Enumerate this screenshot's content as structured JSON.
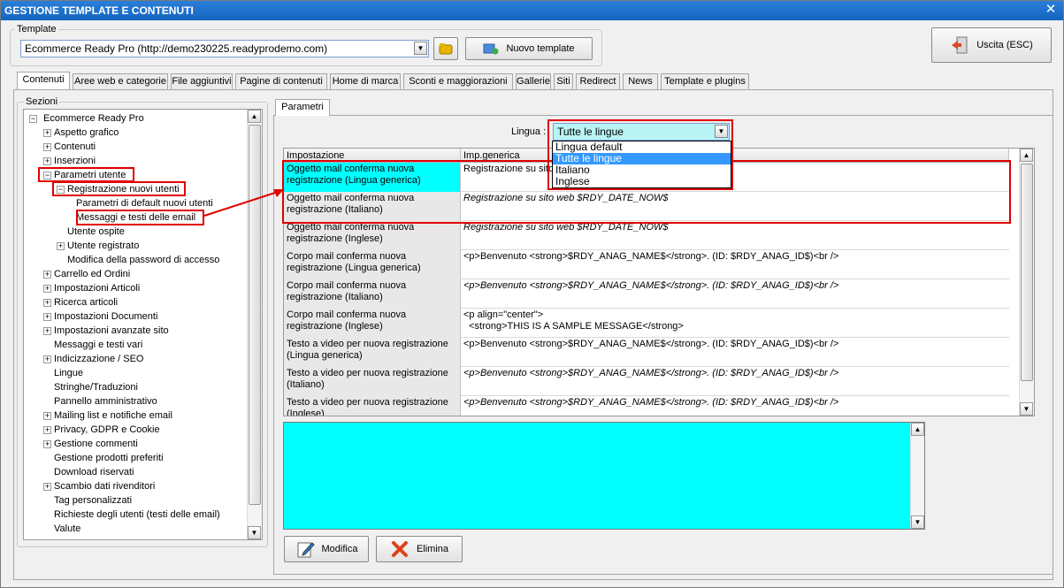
{
  "window": {
    "title": "GESTIONE TEMPLATE E CONTENUTI",
    "close_glyph": "✕"
  },
  "template_group": {
    "label": "Template",
    "selected": "Ecommerce Ready Pro (http://demo230225.readyprodemo.com)",
    "new_template_label": "Nuovo template"
  },
  "exit_button": {
    "label": "Uscita (ESC)"
  },
  "tabs": [
    {
      "label": "Contenuti",
      "active": true
    },
    {
      "label": "Aree web e categorie"
    },
    {
      "label": "File aggiuntivi"
    },
    {
      "label": "Pagine di contenuti"
    },
    {
      "label": "Home di marca"
    },
    {
      "label": "Sconti e maggiorazioni"
    },
    {
      "label": "Gallerie"
    },
    {
      "label": "Siti"
    },
    {
      "label": "Redirect"
    },
    {
      "label": "News"
    },
    {
      "label": "Template e plugins"
    }
  ],
  "sections": {
    "label": "Sezioni",
    "tree": [
      {
        "label": "Ecommerce Ready Pro",
        "level": 0,
        "exp": "−"
      },
      {
        "label": "Aspetto grafico",
        "level": 1,
        "exp": "+"
      },
      {
        "label": "Contenuti",
        "level": 1,
        "exp": "+"
      },
      {
        "label": "Inserzioni",
        "level": 1,
        "exp": "+"
      },
      {
        "label": "Parametri utente",
        "level": 1,
        "exp": "−"
      },
      {
        "label": "Registrazione nuovi utenti",
        "level": 2,
        "exp": "−"
      },
      {
        "label": "Parametri di default nuovi utenti",
        "level": 3
      },
      {
        "label": "Messaggi e testi delle email",
        "level": 3,
        "selected": true
      },
      {
        "label": "Utente ospite",
        "level": 2
      },
      {
        "label": "Utente registrato",
        "level": 2,
        "exp": "+"
      },
      {
        "label": "Modifica della password di accesso",
        "level": 2
      },
      {
        "label": "Carrello ed Ordini",
        "level": 1,
        "exp": "+"
      },
      {
        "label": "Impostazioni Articoli",
        "level": 1,
        "exp": "+"
      },
      {
        "label": "Ricerca articoli",
        "level": 1,
        "exp": "+"
      },
      {
        "label": "Impostazioni Documenti",
        "level": 1,
        "exp": "+"
      },
      {
        "label": "Impostazioni avanzate sito",
        "level": 1,
        "exp": "+"
      },
      {
        "label": "Messaggi e testi vari",
        "level": 1
      },
      {
        "label": "Indicizzazione / SEO",
        "level": 1,
        "exp": "+"
      },
      {
        "label": "Lingue",
        "level": 1
      },
      {
        "label": "Stringhe/Traduzioni",
        "level": 1
      },
      {
        "label": "Pannello amministrativo",
        "level": 1
      },
      {
        "label": "Mailing list e notifiche email",
        "level": 1,
        "exp": "+"
      },
      {
        "label": "Privacy, GDPR e Cookie",
        "level": 1,
        "exp": "+"
      },
      {
        "label": "Gestione commenti",
        "level": 1,
        "exp": "+"
      },
      {
        "label": "Gestione prodotti preferiti",
        "level": 1
      },
      {
        "label": "Download riservati",
        "level": 1
      },
      {
        "label": "Scambio dati rivenditori",
        "level": 1,
        "exp": "+"
      },
      {
        "label": "Tag personalizzati",
        "level": 1
      },
      {
        "label": "Richieste degli utenti (testi delle email)",
        "level": 1
      },
      {
        "label": "Valute",
        "level": 1
      }
    ]
  },
  "params_tab": {
    "label": "Parametri"
  },
  "lingua": {
    "label": "Lingua :",
    "selected": "Tutte le lingue",
    "options": [
      "Lingua default",
      "Tutte le lingue",
      "Italiano",
      "Inglese"
    ]
  },
  "grid": {
    "columns": [
      "Impostazione",
      "Imp.generica"
    ],
    "rows": [
      {
        "setting": "Oggetto mail conferma nuova registrazione (Lingua generica)",
        "value": "Registrazione su sito",
        "italic": false,
        "highlight": true
      },
      {
        "setting": "Oggetto mail conferma nuova registrazione (Italiano)",
        "value": "Registrazione su sito web $RDY_DATE_NOW$",
        "italic": true
      },
      {
        "setting": "Oggetto mail conferma nuova registrazione (Inglese)",
        "value": "Registrazione su sito web $RDY_DATE_NOW$",
        "italic": true
      },
      {
        "setting": "Corpo mail conferma nuova registrazione (Lingua generica)",
        "value": "<p>Benvenuto <strong>$RDY_ANAG_NAME$</strong>. (ID: $RDY_ANAG_ID$)<br />",
        "italic": false
      },
      {
        "setting": "Corpo mail conferma nuova registrazione (Italiano)",
        "value": "<p>Benvenuto <strong>$RDY_ANAG_NAME$</strong>. (ID: $RDY_ANAG_ID$)<br />",
        "italic": true
      },
      {
        "setting": "Corpo mail conferma nuova registrazione (Inglese)",
        "value": "<p align=\"center\">\n  <strong>THIS IS A SAMPLE MESSAGE</strong>",
        "italic": false
      },
      {
        "setting": "Testo a video per nuova registrazione (Lingua generica)",
        "value": "<p>Benvenuto <strong>$RDY_ANAG_NAME$</strong>. (ID: $RDY_ANAG_ID$)<br />",
        "italic": false
      },
      {
        "setting": "Testo a video per nuova registrazione (Italiano)",
        "value": "<p>Benvenuto <strong>$RDY_ANAG_NAME$</strong>. (ID: $RDY_ANAG_ID$)<br />",
        "italic": true
      },
      {
        "setting": "Testo a video per nuova registrazione (Inglese)",
        "value": "<p>Benvenuto <strong>$RDY_ANAG_NAME$</strong>. (ID: $RDY_ANAG_ID$)<br />",
        "italic": true
      }
    ]
  },
  "actions": {
    "edit_label": "Modifica",
    "delete_label": "Elimina"
  },
  "colors": {
    "highlight": "#00ffff",
    "annotation": "#e00000",
    "title_bar": "#1f6fc8"
  }
}
